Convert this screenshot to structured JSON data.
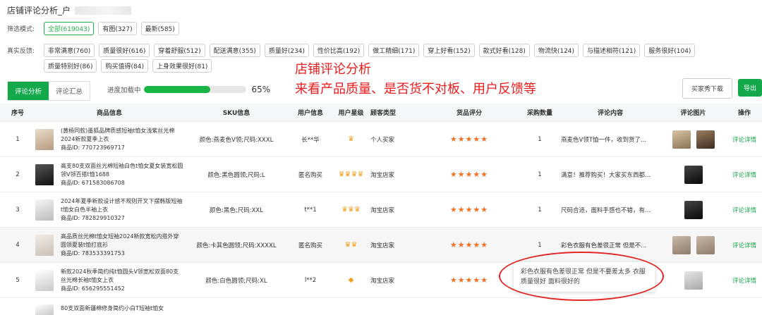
{
  "page": {
    "title": "店铺评论分析_户"
  },
  "filter": {
    "label": "筛选模式:",
    "options": [
      {
        "label": "全部(619043)",
        "active": true
      },
      {
        "label": "有图(327)",
        "active": false
      },
      {
        "label": "最新(585)",
        "active": false
      }
    ]
  },
  "feedback": {
    "label": "真实反馈:",
    "row1": [
      "非常满意(760)",
      "质量很好(616)",
      "穿着舒服(512)",
      "配送满意(355)",
      "质量好(234)",
      "性价比高(192)",
      "做工精细(171)",
      "穿上好看(152)",
      "款式好看(128)",
      "物流快(124)",
      "与描述相符(121)",
      "服务很好(104)"
    ],
    "row2": [
      "质量特别好(86)",
      "购买值得(84)",
      "上身效果很好(81)"
    ]
  },
  "tabs": [
    {
      "label": "评论分析",
      "active": true
    },
    {
      "label": "评论汇总",
      "active": false
    }
  ],
  "progress": {
    "label": "进度加载中",
    "percent_text": "65%",
    "value": 0.65
  },
  "annotation": {
    "line1": "店铺评论分析",
    "line2": "来看产品质量、是否货不对板、用户反馈等"
  },
  "buttons": {
    "buyer_show": "买家秀下载",
    "export": "导出"
  },
  "table": {
    "headers": [
      "序号",
      "商品信息",
      "SKU信息",
      "用户信息",
      "用户星级",
      "顾客类型",
      "货品评分",
      "采购数量",
      "评论内容",
      "评论图片",
      "操作"
    ],
    "rows": [
      {
        "index": "1",
        "title": "(黄杨同款)墨狐品牌质感短袖t恤女浅紫丝光棉2024新款夏季上衣",
        "pid": "商品ID: 770723969717",
        "sku": "颜色:燕麦色V领;尺码:XXXL",
        "user": "长**华",
        "stars": "♛",
        "ctype": "个人买家",
        "rating": "★★★★★",
        "qty": "1",
        "comment": "燕麦色V领T恤一件，收到货了...",
        "action": "评论详情",
        "thumb": "t1",
        "imgs": [
          "a",
          "b"
        ]
      },
      {
        "index": "2",
        "title": "高支80支双面丝光棉短袖白色t恤女夏女装宽松圆领V领百搭t恤1688",
        "pid": "商品ID: 671583086708",
        "sku": "颜色:黑色圆领;尺码:L",
        "user": "匿名购买",
        "stars": "♛♛♛♛",
        "ctype": "淘宝店家",
        "rating": "★★★★★",
        "qty": "1",
        "comment": "满意！推荐购买！大家买东西都...",
        "action": "评论详情",
        "thumb": "t2",
        "imgs": [
          "k"
        ]
      },
      {
        "index": "3",
        "title": "2024年夏季新款设计感不规则开叉下摆韩版短袖t恤女白色半袖上衣",
        "pid": "商品ID: 782829910327",
        "sku": "颜色:黑色;尺码:XXL",
        "user": "t**1",
        "stars": "♛♛♛",
        "ctype": "淘宝店家",
        "rating": "★★★★★",
        "qty": "1",
        "comment": "尺码合适，面料手感也不错，有...",
        "action": "评论详情",
        "thumb": "t3",
        "imgs": [
          "k"
        ]
      },
      {
        "index": "4",
        "title": "高品质丝光棉t恤女短袖2024新款宽松内搭外穿圆领夏装t恤打底衫",
        "pid": "商品ID: 783533391753",
        "sku": "颜色:卡其色圆领;尺码:XXXXL",
        "user": "匿名购买",
        "stars": "♛♛",
        "ctype": "淘宝店家",
        "rating": "★★★★★",
        "qty": "1",
        "comment": "彩色衣服有色差很正常 但是不...",
        "action": "评论详情",
        "thumb": "t4",
        "imgs": [
          "g",
          "g"
        ]
      },
      {
        "index": "5",
        "title": "新款2024秋季简约纯t恤圆头V领宽松双面80支丝光棉长袖t恤女上衣",
        "pid": "商品ID: 656295551452",
        "sku": "颜色:白色圆领;尺码:XL",
        "user": "l**2",
        "stars": "◆",
        "ctype": "淘宝店家",
        "rating": "★★★★★",
        "qty": "1",
        "comment": "",
        "action": "评论详情",
        "thumb": "t5",
        "imgs": [
          "w"
        ]
      }
    ],
    "partial_row_title": "80支双面新疆棉修身简约小白T短袖t恤女"
  },
  "tooltip": {
    "text": "彩色衣服有色差很正常 但是不要差太多 衣服质量很好 面料很好的"
  },
  "colors": {
    "accent": "#13a84a",
    "annotation": "#f01b1b",
    "star": "#f37021",
    "medal": "#f1a01f"
  }
}
